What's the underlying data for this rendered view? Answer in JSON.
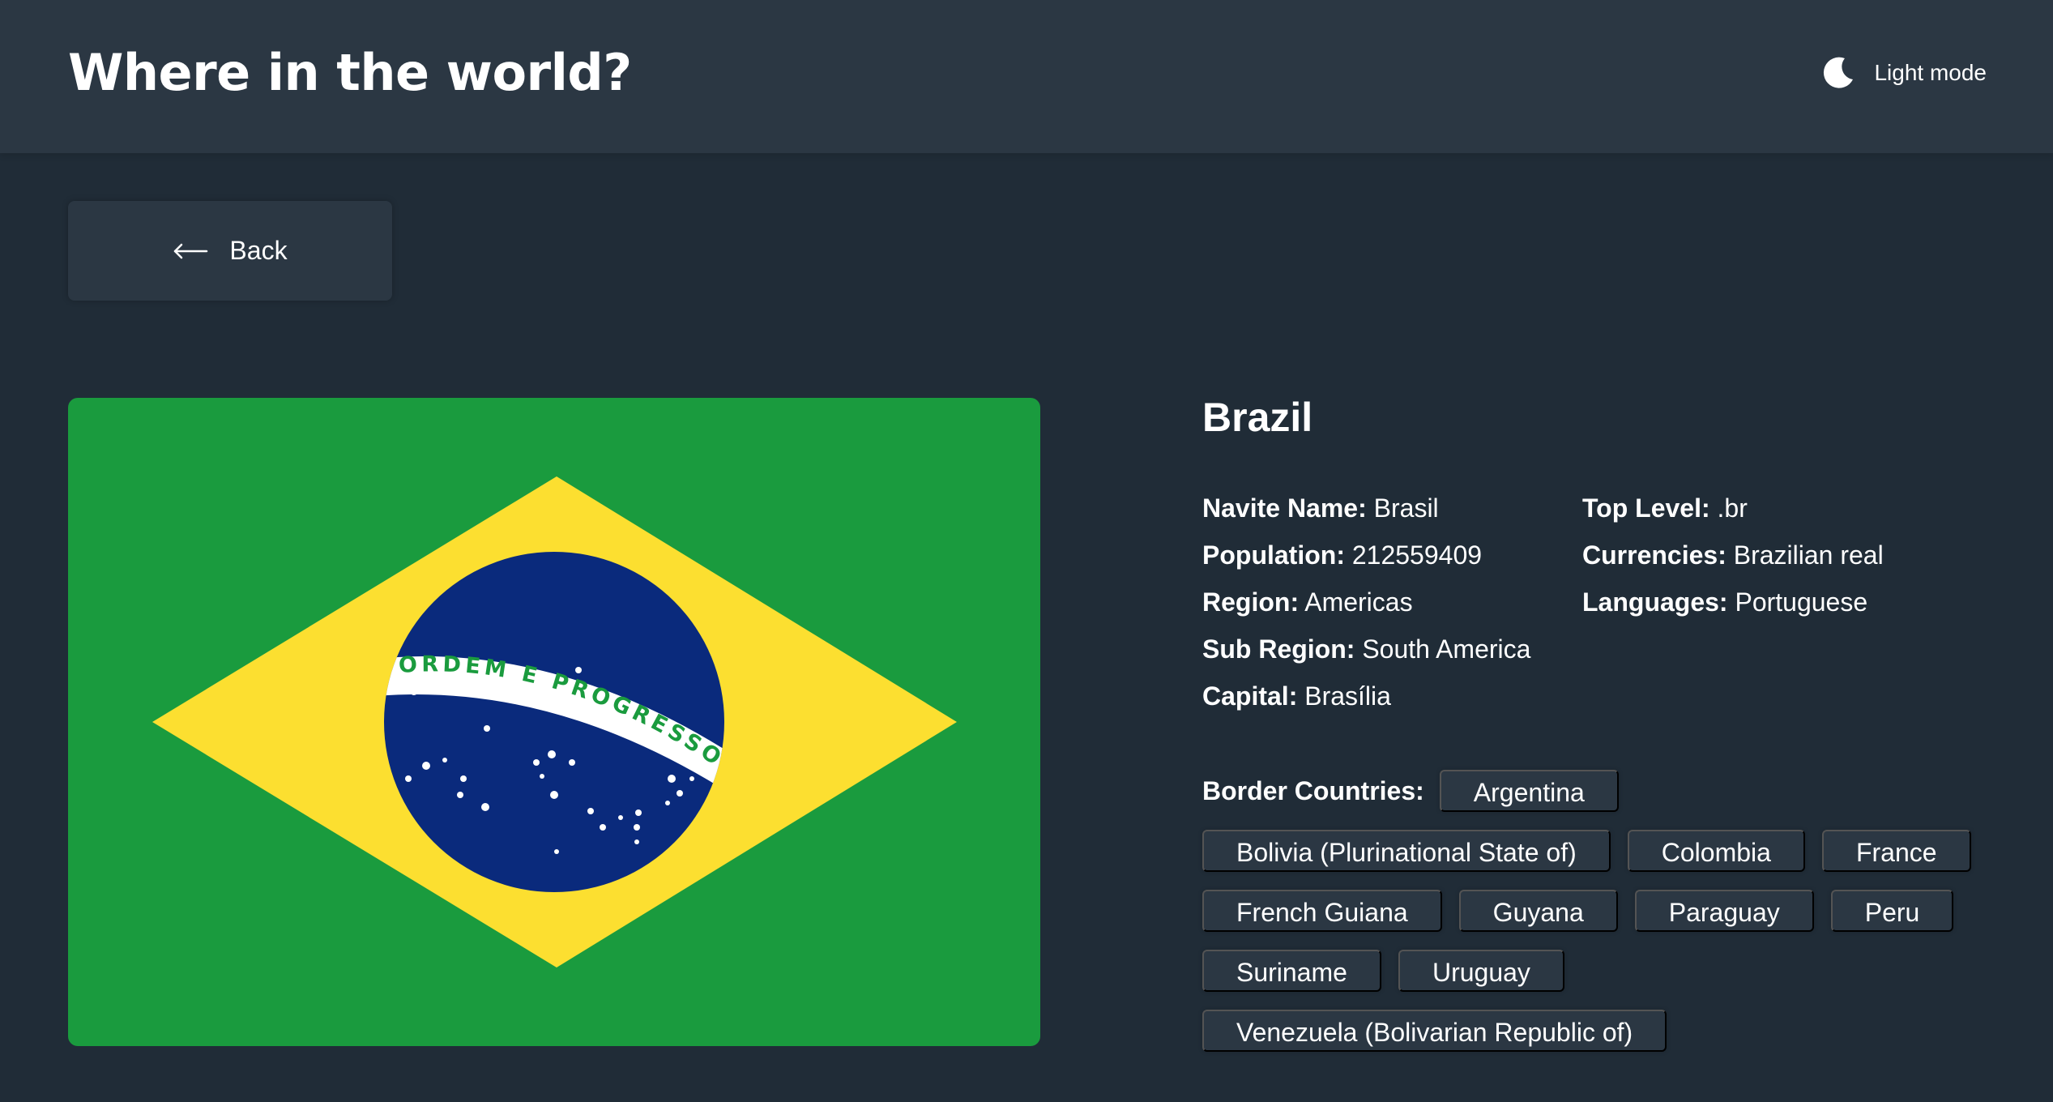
{
  "header": {
    "title": "Where in the world?",
    "theme_toggle": {
      "icon": "moon-icon",
      "label": "Light mode"
    }
  },
  "back_button": {
    "icon": "arrow-left-icon",
    "label": "Back"
  },
  "flag": {
    "country": "Brazil",
    "banner_text": "ORDEM E PROGRESSO",
    "colors": {
      "green": "#1a9b3e",
      "yellow": "#fcdf30",
      "blue": "#0a2a7c",
      "white": "#ffffff"
    }
  },
  "country": {
    "name": "Brazil",
    "native_name": {
      "label": "Navite Name:",
      "value": "Brasil"
    },
    "population": {
      "label": "Population:",
      "value": "212559409"
    },
    "region": {
      "label": "Region:",
      "value": "Americas"
    },
    "sub_region": {
      "label": "Sub Region:",
      "value": "South America"
    },
    "capital": {
      "label": "Capital:",
      "value": "Brasília"
    },
    "top_level": {
      "label": "Top Level:",
      "value": ".br"
    },
    "currencies": {
      "label": "Currencies:",
      "value": "Brazilian real"
    },
    "languages": {
      "label": "Languages:",
      "value": "Portuguese"
    }
  },
  "borders": {
    "label": "Border Countries:",
    "countries": [
      "Argentina",
      "Bolivia (Plurinational State of)",
      "Colombia",
      "France",
      "French Guiana",
      "Guyana",
      "Paraguay",
      "Peru",
      "Suriname",
      "Uruguay",
      "Venezuela (Bolivarian Republic of)"
    ]
  },
  "colors": {
    "background": "#202c37",
    "element": "#2b3743",
    "text": "#ffffff"
  }
}
